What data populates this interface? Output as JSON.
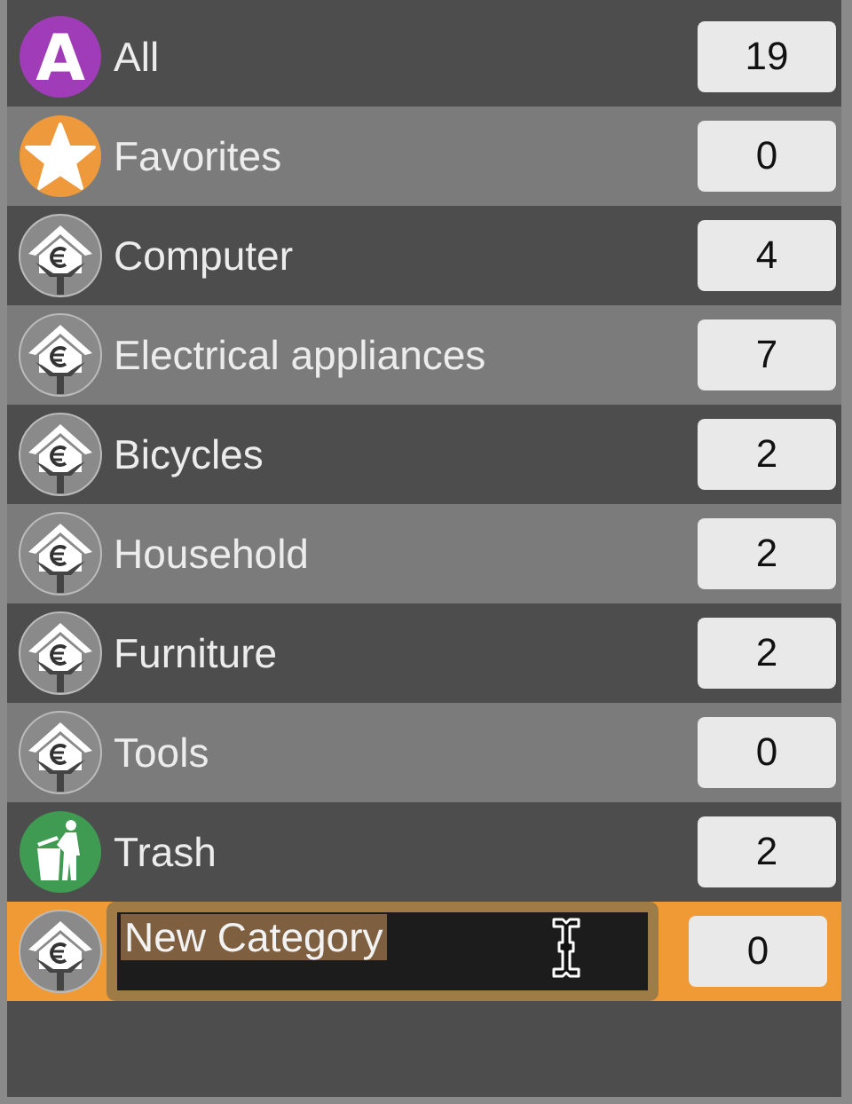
{
  "categories": [
    {
      "name": "All",
      "count": "19",
      "kind": "letter",
      "icon_letter": "A",
      "selected": false,
      "editing": false
    },
    {
      "name": "Favorites",
      "count": "0",
      "kind": "star",
      "selected": false,
      "editing": false
    },
    {
      "name": "Computer",
      "count": "4",
      "kind": "house",
      "selected": false,
      "editing": false
    },
    {
      "name": "Electrical appliances",
      "count": "7",
      "kind": "house",
      "selected": false,
      "editing": false
    },
    {
      "name": "Bicycles",
      "count": "2",
      "kind": "house",
      "selected": false,
      "editing": false
    },
    {
      "name": "Household",
      "count": "2",
      "kind": "house",
      "selected": false,
      "editing": false
    },
    {
      "name": "Furniture",
      "count": "2",
      "kind": "house",
      "selected": false,
      "editing": false
    },
    {
      "name": "Tools",
      "count": "0",
      "kind": "house",
      "selected": false,
      "editing": false
    },
    {
      "name": "Trash",
      "count": "2",
      "kind": "trash",
      "selected": false,
      "editing": false
    },
    {
      "name": "New Category",
      "count": "0",
      "kind": "house",
      "selected": true,
      "editing": true
    }
  ]
}
